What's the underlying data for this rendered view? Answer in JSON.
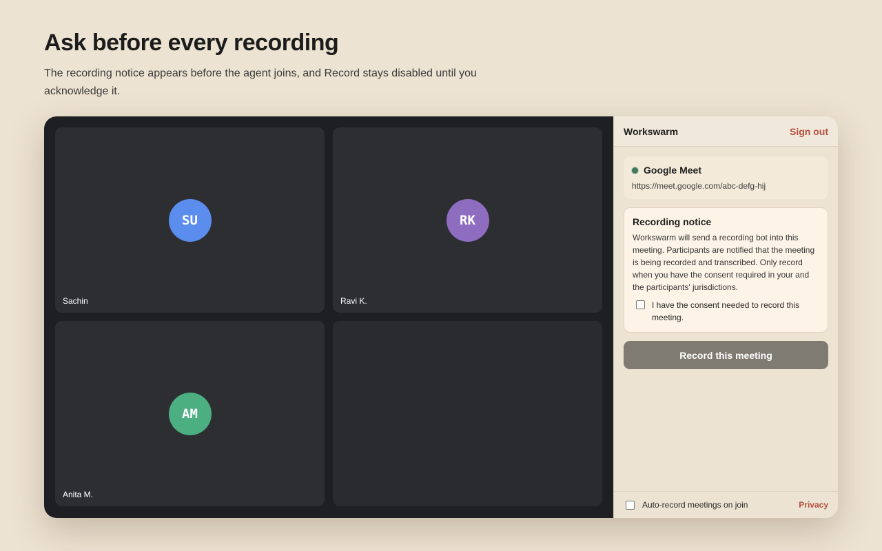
{
  "hero": {
    "title": "Ask before every recording",
    "subtitle": "The recording notice appears before the agent joins, and Record stays disabled until you acknowledge it."
  },
  "participants": [
    {
      "initials": "SU",
      "name": "Sachin",
      "color": "#5b8def"
    },
    {
      "initials": "RK",
      "name": "Ravi K.",
      "color": "#8e6cc0"
    },
    {
      "initials": "AM",
      "name": "Anita M.",
      "color": "#4caf82"
    }
  ],
  "panel": {
    "brand": "Workswarm",
    "sign_out": "Sign out",
    "meeting": {
      "platform": "Google Meet",
      "url": "https://meet.google.com/abc-defg-hij",
      "status_color": "#3f7a5c"
    },
    "notice": {
      "title": "Recording notice",
      "body": "Workswarm will send a recording bot into this meeting. Participants are notified that the meeting is being recorded and transcribed. Only record when you have the consent required in your and the participants' jurisdictions.",
      "consent_label": "I have the consent needed to record this meeting.",
      "consent_checked": false
    },
    "record_button": {
      "label": "Record this meeting",
      "disabled": true
    },
    "footer": {
      "auto_record_label": "Auto-record meetings on join",
      "auto_record_checked": false,
      "privacy": "Privacy"
    }
  },
  "colors": {
    "background": "#ede3d2",
    "stage": "#1e1f22",
    "accent": "#b5503f",
    "disabled_button": "#7f7b72"
  }
}
